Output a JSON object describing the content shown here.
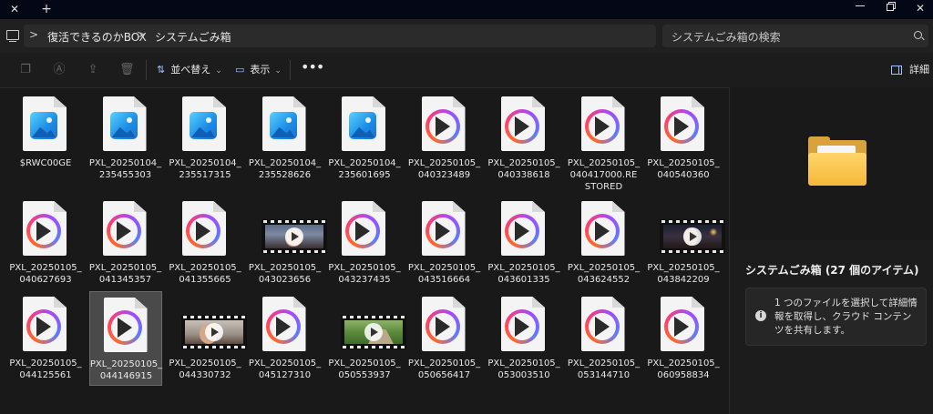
{
  "titlebar": {
    "close_glyph": "✕",
    "newtab_glyph": "+",
    "close_window_glyph": "✕"
  },
  "address": {
    "breadcrumbs": [
      "復活できるのかBOX",
      "システムごみ箱"
    ],
    "separator": ">"
  },
  "search": {
    "placeholder": "システムごみ箱の検索"
  },
  "toolbar": {
    "sort_label": "並べ替え",
    "view_label": "表示",
    "more_glyph": "•••",
    "details_label": "詳細",
    "sort_glyph": "⇅",
    "view_glyph": "▭",
    "chevron": "⌄"
  },
  "colors": {
    "accent": "#9cc3ff",
    "background": "#191919",
    "selection": "#4a4a4a"
  },
  "files": [
    {
      "name": "$RWC00GE",
      "kind": "image"
    },
    {
      "name": "PXL_20250104_235455303",
      "kind": "image"
    },
    {
      "name": "PXL_20250104_235517315",
      "kind": "image"
    },
    {
      "name": "PXL_20250104_235528626",
      "kind": "image"
    },
    {
      "name": "PXL_20250104_235601695",
      "kind": "image"
    },
    {
      "name": "PXL_20250105_040323489",
      "kind": "video"
    },
    {
      "name": "PXL_20250105_040338618",
      "kind": "video"
    },
    {
      "name": "PXL_20250105_040417000.RESTORED",
      "kind": "video"
    },
    {
      "name": "PXL_20250105_040540360",
      "kind": "video"
    },
    {
      "name": "PXL_20250105_040627693",
      "kind": "video"
    },
    {
      "name": "PXL_20250105_041345357",
      "kind": "video"
    },
    {
      "name": "PXL_20250105_041355665",
      "kind": "video"
    },
    {
      "name": "PXL_20250105_043023656",
      "kind": "film-street"
    },
    {
      "name": "PXL_20250105_043237435",
      "kind": "video"
    },
    {
      "name": "PXL_20250105_043516664",
      "kind": "video"
    },
    {
      "name": "PXL_20250105_043601335",
      "kind": "video"
    },
    {
      "name": "PXL_20250105_043624552",
      "kind": "video"
    },
    {
      "name": "PXL_20250105_043842209",
      "kind": "film-night"
    },
    {
      "name": "PXL_20250105_044125561",
      "kind": "video"
    },
    {
      "name": "PXL_20250105_044146915",
      "kind": "video",
      "selected": true
    },
    {
      "name": "PXL_20250105_044330732",
      "kind": "film-indoor"
    },
    {
      "name": "PXL_20250105_045127310",
      "kind": "video"
    },
    {
      "name": "PXL_20250105_050553937",
      "kind": "film-garden"
    },
    {
      "name": "PXL_20250105_050656417",
      "kind": "video"
    },
    {
      "name": "PXL_20250105_053003510",
      "kind": "video"
    },
    {
      "name": "PXL_20250105_053144710",
      "kind": "video"
    },
    {
      "name": "PXL_20250105_060958834",
      "kind": "video"
    }
  ],
  "details_pane": {
    "title": "システムごみ箱 (27 個のアイテム)",
    "info_glyph": "i",
    "info_text": "1 つのファイルを選択して詳細情報を取得し、クラウド コンテンツを共有します。"
  }
}
